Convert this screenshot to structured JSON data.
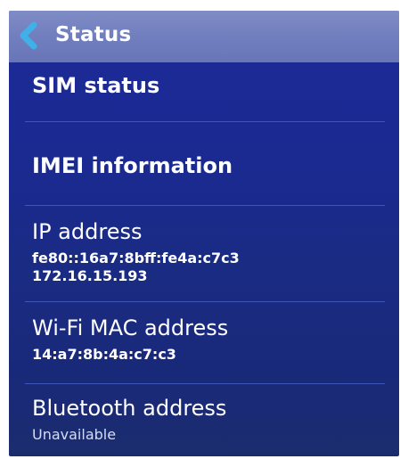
{
  "header": {
    "title": "Status"
  },
  "items": [
    {
      "label": "SIM status"
    },
    {
      "label": "IMEI information"
    },
    {
      "label": "IP address",
      "values": [
        "fe80::16a7:8bff:fe4a:c7c3",
        "172.16.15.193"
      ]
    },
    {
      "label": "Wi-Fi MAC address",
      "values": [
        "14:a7:8b:4a:c7:c3"
      ]
    },
    {
      "label": "Bluetooth address",
      "values": [
        "Unavailable"
      ]
    }
  ],
  "colors": {
    "background": "#1a2a90",
    "header": "#7382c0",
    "accent": "#3fb0e8",
    "divider": "#3f55b8"
  }
}
